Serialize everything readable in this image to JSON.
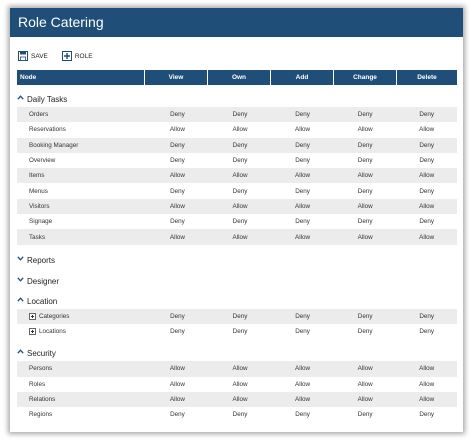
{
  "window": {
    "title": "Role Catering"
  },
  "toolbar": {
    "save_label": "SAVE",
    "role_label": "ROLE"
  },
  "table": {
    "headers": [
      "Node",
      "View",
      "Own",
      "Add",
      "Change",
      "Delete"
    ]
  },
  "groups": [
    {
      "name": "Daily Tasks",
      "expanded": true,
      "rows": [
        {
          "node": "Orders",
          "values": [
            "Deny",
            "Deny",
            "Deny",
            "Deny",
            "Deny"
          ]
        },
        {
          "node": "Reservations",
          "values": [
            "Allow",
            "Allow",
            "Allow",
            "Allow",
            "Allow"
          ]
        },
        {
          "node": "Booking Manager",
          "values": [
            "Deny",
            "Deny",
            "Deny",
            "Deny",
            "Deny"
          ]
        },
        {
          "node": "Overview",
          "values": [
            "Deny",
            "Deny",
            "Deny",
            "Deny",
            "Deny"
          ]
        },
        {
          "node": "Items",
          "values": [
            "Allow",
            "Allow",
            "Allow",
            "Allow",
            "Allow"
          ]
        },
        {
          "node": "Menus",
          "values": [
            "Deny",
            "Deny",
            "Deny",
            "Deny",
            "Deny"
          ]
        },
        {
          "node": "Visitors",
          "values": [
            "Allow",
            "Allow",
            "Allow",
            "Allow",
            "Allow"
          ]
        },
        {
          "node": "Signage",
          "values": [
            "Deny",
            "Deny",
            "Deny",
            "Deny",
            "Deny"
          ]
        },
        {
          "node": "Tasks",
          "values": [
            "Allow",
            "Allow",
            "Allow",
            "Allow",
            "Allow"
          ]
        }
      ]
    },
    {
      "name": "Reports",
      "expanded": false,
      "rows": []
    },
    {
      "name": "Designer",
      "expanded": false,
      "rows": []
    },
    {
      "name": "Location",
      "expanded": true,
      "rows": [
        {
          "node": "Categories",
          "tree": true,
          "values": [
            "Deny",
            "Deny",
            "Deny",
            "Deny",
            "Deny"
          ]
        },
        {
          "node": "Locations",
          "tree": true,
          "values": [
            "Deny",
            "Deny",
            "Deny",
            "Deny",
            "Deny"
          ]
        }
      ]
    },
    {
      "name": "Security",
      "expanded": true,
      "rows": [
        {
          "node": "Persons",
          "values": [
            "Allow",
            "Allow",
            "Allow",
            "Allow",
            "Allow"
          ]
        },
        {
          "node": "Roles",
          "values": [
            "Allow",
            "Allow",
            "Allow",
            "Allow",
            "Allow"
          ]
        },
        {
          "node": "Relations",
          "values": [
            "Allow",
            "Allow",
            "Allow",
            "Allow",
            "Allow"
          ]
        },
        {
          "node": "Regions",
          "values": [
            "Deny",
            "Deny",
            "Deny",
            "Deny",
            "Deny"
          ]
        }
      ]
    }
  ],
  "colors": {
    "accent": "#1f4e79",
    "row_alt": "#ececec"
  }
}
